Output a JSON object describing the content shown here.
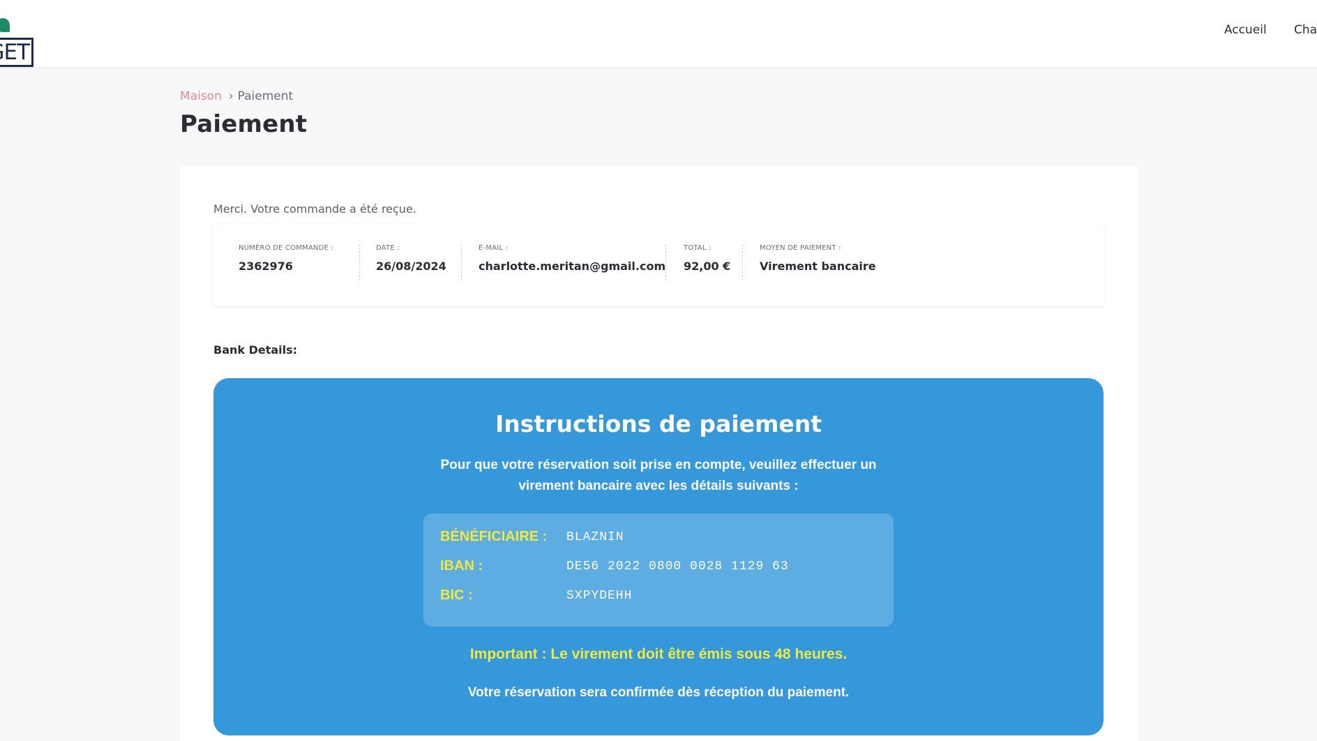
{
  "header": {
    "logo_text": "GET",
    "nav": [
      {
        "label": "Accueil"
      },
      {
        "label": "Char"
      }
    ]
  },
  "breadcrumb": {
    "home": "Maison",
    "separator": "›",
    "current": "Paiement"
  },
  "page_title": "Paiement",
  "order": {
    "thanks": "Merci. Votre commande a été reçue.",
    "fields": [
      {
        "label": "Numéro de commande :",
        "value": "2362976"
      },
      {
        "label": "Date :",
        "value": "26/08/2024"
      },
      {
        "label": "E-mail :",
        "value": "charlotte.meritan@gmail.com"
      },
      {
        "label": "Total :",
        "value": "92,00 €"
      },
      {
        "label": "Moyen de paiement :",
        "value": "Virement bancaire"
      }
    ]
  },
  "bank_details_title": "Bank Details:",
  "instructions": {
    "title": "Instructions de paiement",
    "text": "Pour que votre réservation soit prise en compte, veuillez effectuer un virement bancaire avec les détails suivants :",
    "rows": [
      {
        "key": "BÉNÉFICIAIRE :",
        "value": "BLAZNIN"
      },
      {
        "key": "IBAN :",
        "value": "DE56 2022 0800 0028 1129 63"
      },
      {
        "key": "BIC :",
        "value": "SXPYDEHH"
      }
    ],
    "important": "Important : Le virement doit être émis sous 48 heures.",
    "confirmation": "Votre réservation sera confirmée dès réception du paiement."
  },
  "colors": {
    "instruction_bg": "#3498db",
    "bank_box_bg": "#5dade2",
    "highlight_yellow": "#f1e93b",
    "breadcrumb_link": "#e58a8a"
  }
}
